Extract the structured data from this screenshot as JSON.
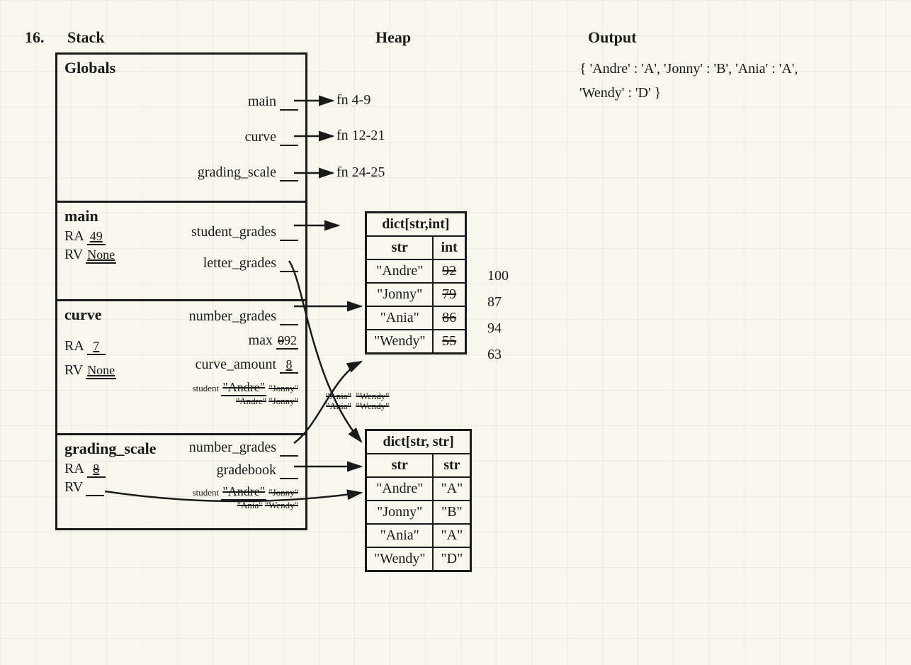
{
  "problem_number": "16.",
  "headings": {
    "stack": "Stack",
    "heap": "Heap",
    "output": "Output"
  },
  "output_lines": [
    "{ 'Andre' : 'A', 'Jonny' : 'B', 'Ania' : 'A',",
    "  'Wendy' : 'D' }"
  ],
  "globals": {
    "title": "Globals",
    "vars": [
      {
        "name": "main",
        "target": "fn 4-9"
      },
      {
        "name": "curve",
        "target": "fn 12-21"
      },
      {
        "name": "grading_scale",
        "target": "fn 24-25"
      }
    ]
  },
  "frames": {
    "main": {
      "title": "main",
      "ra": "49",
      "rv": "None",
      "vars": [
        {
          "name": "student_grades"
        },
        {
          "name": "letter_grades"
        }
      ]
    },
    "curve": {
      "title": "curve",
      "ra": "7",
      "rv": "None",
      "number_grades": "number_grades",
      "max_old": "0",
      "max_new": "92",
      "curve_amount": "8",
      "student_loop1": [
        "\"Andre\"",
        "\"Jonny\"",
        "\"Ania\"",
        "\"Wendy\""
      ],
      "student_loop2": [
        "\"Andre\"",
        "\"Jonny\"",
        "\"Ania\"",
        "\"Wendy\""
      ]
    },
    "gscale": {
      "title": "grading_scale",
      "ra_old": "8",
      "ra_new": "",
      "number_grades": "number_grades",
      "gradebook": "gradebook",
      "student_loop": [
        "\"Andre\"",
        "\"Jonny\"",
        "\"Ania\"",
        "\"Wendy\""
      ]
    }
  },
  "heap": {
    "dict1": {
      "type": "dict[str,int]",
      "header": [
        "str",
        "int"
      ],
      "rows": [
        {
          "k": "\"Andre\"",
          "old": "92",
          "new": "100"
        },
        {
          "k": "\"Jonny\"",
          "old": "79",
          "new": "87"
        },
        {
          "k": "\"Ania\"",
          "old": "86",
          "new": "94"
        },
        {
          "k": "\"Wendy\"",
          "old": "55",
          "new": "63"
        }
      ]
    },
    "dict2": {
      "type": "dict[str, str]",
      "header": [
        "str",
        "str"
      ],
      "rows": [
        {
          "k": "\"Andre\"",
          "v": "\"A\""
        },
        {
          "k": "\"Jonny\"",
          "v": "\"B\""
        },
        {
          "k": "\"Ania\"",
          "v": "\"A\""
        },
        {
          "k": "\"Wendy\"",
          "v": "\"D\""
        }
      ]
    }
  }
}
